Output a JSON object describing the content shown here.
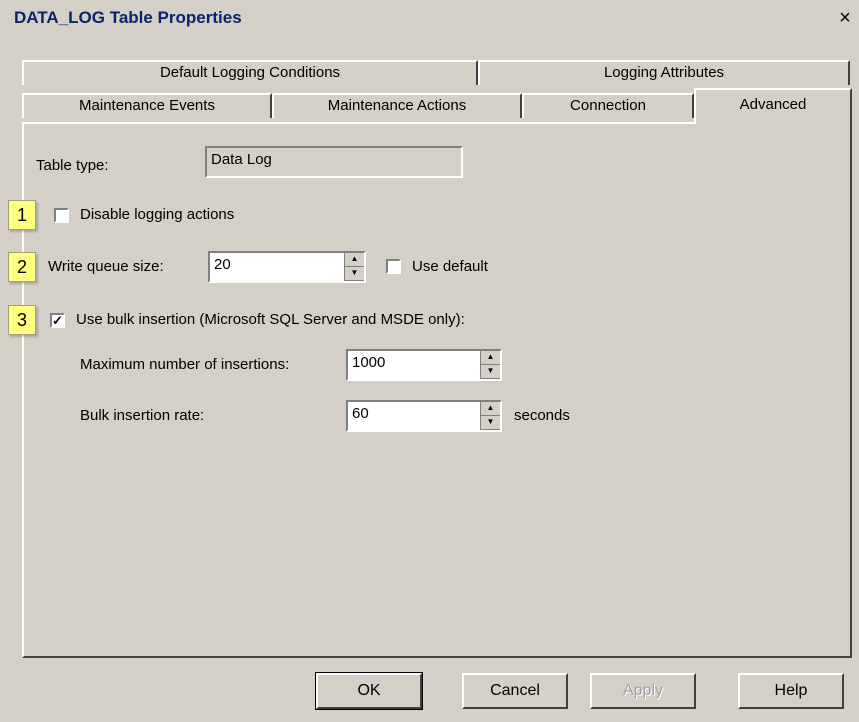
{
  "window": {
    "title": "DATA_LOG Table Properties",
    "close_glyph": "×"
  },
  "tabs_back": [
    {
      "label": "Default Logging Conditions"
    },
    {
      "label": "Logging Attributes"
    }
  ],
  "tabs_front": [
    {
      "label": "Maintenance Events"
    },
    {
      "label": "Maintenance Actions"
    },
    {
      "label": "Connection"
    },
    {
      "label": "Advanced"
    }
  ],
  "advanced": {
    "table_type": {
      "label": "Table type:",
      "value": "Data Log"
    },
    "disable_logging": {
      "label": "Disable logging actions",
      "checked": false
    },
    "write_queue": {
      "label": "Write queue size:",
      "value": "20"
    },
    "use_default": {
      "label": "Use default",
      "checked": false
    },
    "bulk_insertion": {
      "label": "Use bulk insertion (Microsoft SQL Server and MSDE only):",
      "checked": true
    },
    "max_insertions": {
      "label": "Maximum number of insertions:",
      "value": "1000"
    },
    "bulk_rate": {
      "label": "Bulk insertion rate:",
      "value": "60",
      "unit": "seconds"
    }
  },
  "callouts": [
    "1",
    "2",
    "3"
  ],
  "buttons": {
    "ok": "OK",
    "cancel": "Cancel",
    "apply": "Apply",
    "help": "Help"
  }
}
